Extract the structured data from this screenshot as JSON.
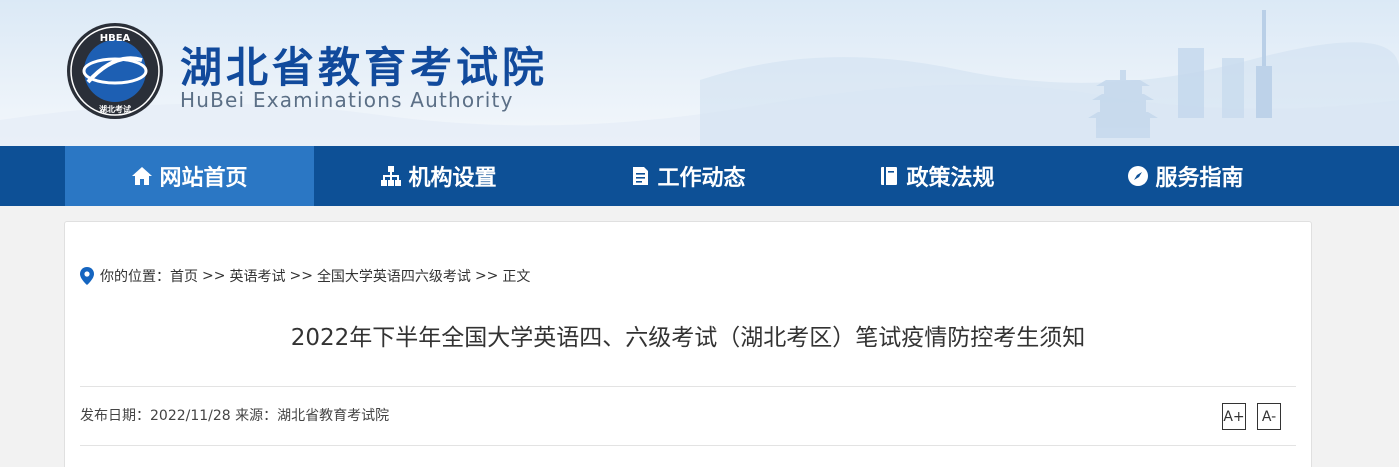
{
  "header": {
    "logo_text": "HBEA",
    "logo_caption": "湖北考试",
    "title": "湖北省教育考试院",
    "subtitle": "HuBei Examinations Authority"
  },
  "nav": {
    "items": [
      {
        "label": "网站首页",
        "icon": "home-icon"
      },
      {
        "label": "机构设置",
        "icon": "org-chart-icon"
      },
      {
        "label": "工作动态",
        "icon": "document-icon"
      },
      {
        "label": "政策法规",
        "icon": "book-icon"
      },
      {
        "label": "服务指南",
        "icon": "compass-icon"
      }
    ],
    "active_index": 0,
    "colors": {
      "bar": "#0d5096",
      "active": "#2b77c4"
    }
  },
  "breadcrumb": {
    "prefix": "你的位置：",
    "items": [
      "首页",
      "英语考试",
      "全国大学英语四六级考试",
      "正文"
    ],
    "separator": ">>"
  },
  "article": {
    "title": "2022年下半年全国大学英语四、六级考试（湖北考区）笔试疫情防控考生须知",
    "meta": "发布日期：2022/11/28 来源：湖北省教育考试院",
    "font_increase_label": "A+",
    "font_decrease_label": "A-"
  }
}
